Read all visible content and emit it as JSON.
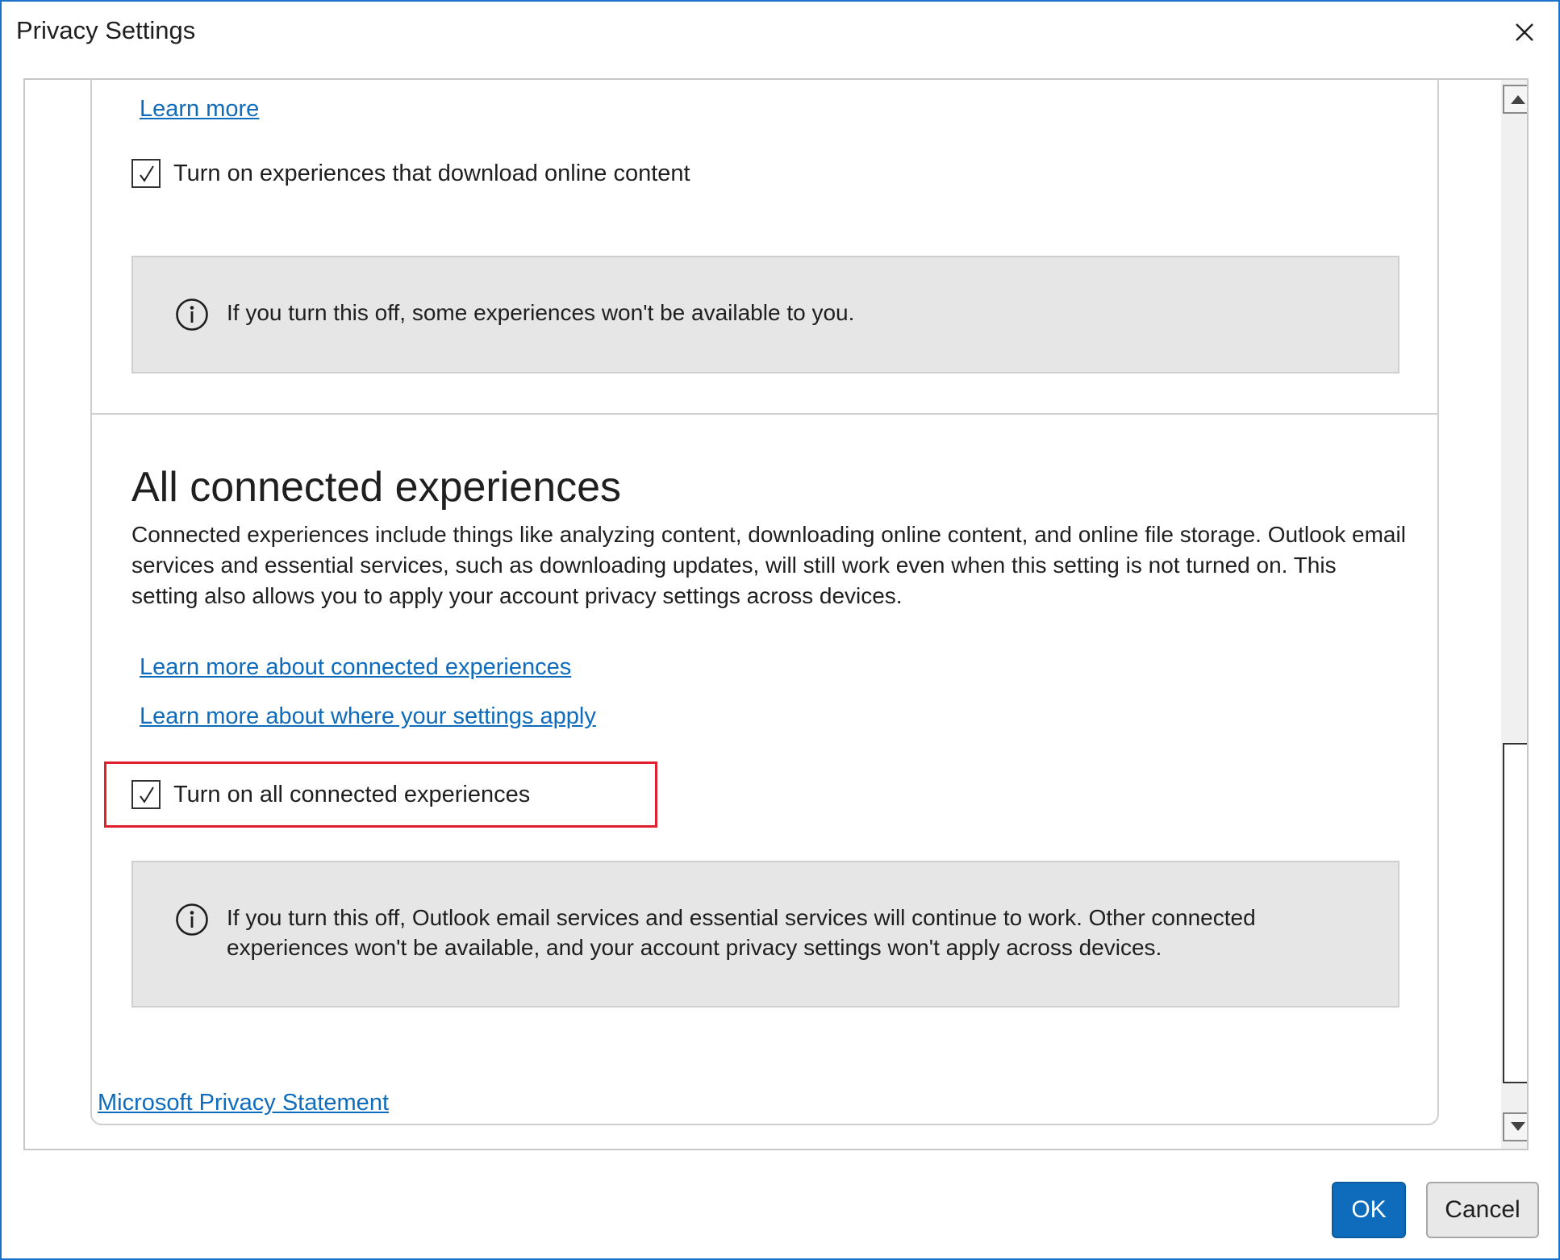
{
  "window": {
    "title": "Privacy Settings",
    "close_icon": "close-icon"
  },
  "top_section": {
    "learn_more_link": "Learn more",
    "checkbox_label": "Turn on experiences that download online content",
    "checkbox_checked": true,
    "info_text": "If you turn this off, some experiences won't be available to you."
  },
  "connected_section": {
    "heading": "All connected experiences",
    "description": "Connected experiences include things like analyzing content, downloading online content, and online file storage. Outlook email services and essential services, such as downloading updates, will still work even when this setting is not turned on. This setting also allows you to apply your account privacy settings across devices.",
    "link_connected": "Learn more about connected experiences",
    "link_settings": "Learn more about where your settings apply",
    "checkbox_label": "Turn on all connected experiences",
    "checkbox_checked": true,
    "info_text": "If you turn this off, Outlook email services and essential services will continue to work. Other connected experiences won't be available, and your account privacy settings won't apply across devices."
  },
  "footer": {
    "privacy_link": "Microsoft Privacy Statement",
    "ok_label": "OK",
    "cancel_label": "Cancel"
  },
  "colors": {
    "accent": "#0f6cbd",
    "highlight": "#e0202d",
    "info_background": "#e6e6e6"
  }
}
